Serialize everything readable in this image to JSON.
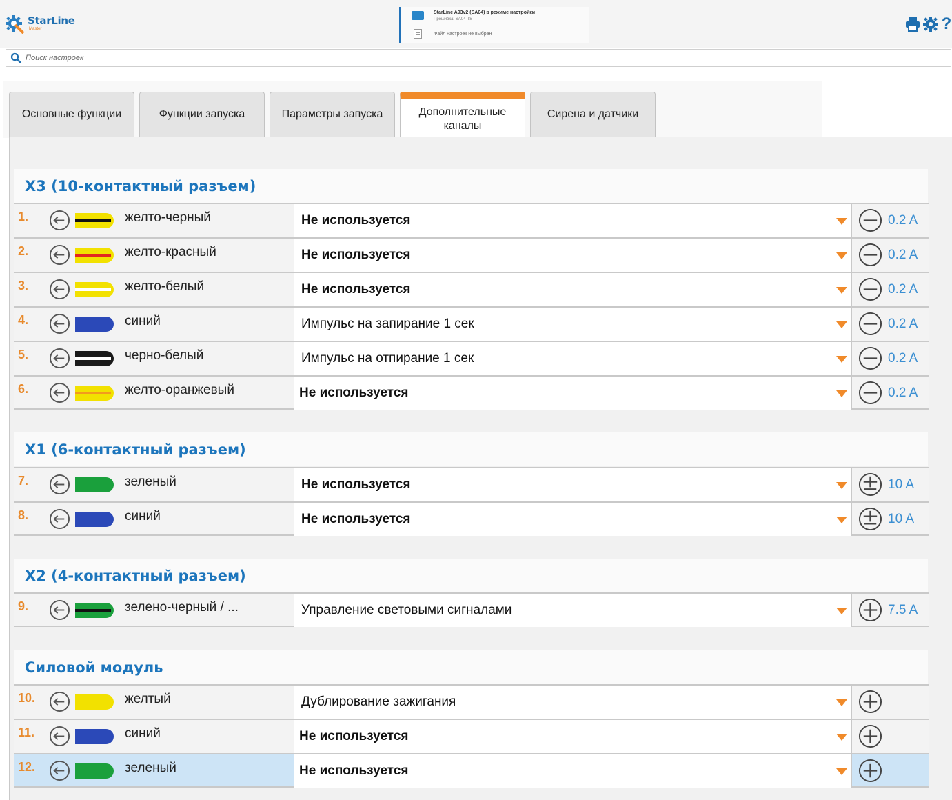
{
  "app": {
    "logo_name": "StarLine",
    "logo_sub": "Master",
    "device_title": "StarLine A93v2 (SA04) в режиме настройки",
    "device_firmware": "Прошивка: SA04-TS",
    "device_file": "Файл настроек не выбран"
  },
  "search": {
    "placeholder": "Поиск настроек"
  },
  "tabs": [
    {
      "label": "Основные функции"
    },
    {
      "label": "Функции запуска"
    },
    {
      "label": "Параметры запуска"
    },
    {
      "label": "Дополнительные каналы",
      "active": true
    },
    {
      "label": "Сирена и датчики"
    }
  ],
  "sections": [
    {
      "title": "X3 (10-контактный разъем)",
      "rows": [
        {
          "num": "1.",
          "wire_base": "#f2e100",
          "wire_stripe": "#111111",
          "label": "желто-черный",
          "value": "Не используется",
          "polarity": "minus",
          "current": "0.2 A"
        },
        {
          "num": "2.",
          "wire_base": "#f2e100",
          "wire_stripe": "#e3261f",
          "label": "желто-красный",
          "value": "Не используется",
          "polarity": "minus",
          "current": "0.2 A"
        },
        {
          "num": "3.",
          "wire_base": "#f2e100",
          "wire_stripe": "#ffffff",
          "label": "желто-белый",
          "value": "Не используется",
          "polarity": "minus",
          "current": "0.2 A"
        },
        {
          "num": "4.",
          "wire_base": "#2b49b8",
          "wire_stripe": "",
          "label": "синий",
          "value": "Импульс на запирание 1 сек",
          "polarity": "minus",
          "current": "0.2 A"
        },
        {
          "num": "5.",
          "wire_base": "#1a1a1a",
          "wire_stripe": "#ffffff",
          "label": "черно-белый",
          "value": "Импульс на отпирание 1 сек",
          "polarity": "minus",
          "current": "0.2 A"
        },
        {
          "num": "6.",
          "wire_base": "#f2e100",
          "wire_stripe": "#f39a1e",
          "label": "желто-оранжевый",
          "value": "Не используется",
          "polarity": "minus",
          "current": "0.2 A"
        }
      ]
    },
    {
      "title": "X1 (6-контактный разъем)",
      "rows": [
        {
          "num": "7.",
          "wire_base": "#1aa03c",
          "wire_stripe": "",
          "label": "зеленый",
          "value": "Не используется",
          "polarity": "plus-minus",
          "current": "10 A"
        },
        {
          "num": "8.",
          "wire_base": "#2b49b8",
          "wire_stripe": "",
          "label": "синий",
          "value": "Не используется",
          "polarity": "plus-minus",
          "current": "10 A"
        }
      ]
    },
    {
      "title": "X2 (4-контактный разъем)",
      "rows": [
        {
          "num": "9.",
          "wire_base": "#1aa03c",
          "wire_stripe": "#111111",
          "label": "зелено-черный / ...",
          "value": "Управление световыми сигналами",
          "polarity": "plus",
          "current": "7.5 A"
        }
      ]
    },
    {
      "title": "Силовой модуль",
      "rows": [
        {
          "num": "10.",
          "wire_base": "#f2e100",
          "wire_stripe": "",
          "label": "желтый",
          "value": "Дублирование зажигания",
          "polarity": "plus",
          "current": ""
        },
        {
          "num": "11.",
          "wire_base": "#2b49b8",
          "wire_stripe": "",
          "label": "синий",
          "value": "Не используется",
          "polarity": "plus",
          "current": ""
        },
        {
          "num": "12.",
          "wire_base": "#1aa03c",
          "wire_stripe": "",
          "label": "зеленый",
          "value": "Не используется",
          "polarity": "plus",
          "current": "",
          "selected": true
        }
      ]
    }
  ],
  "colors": {
    "accent": "#f08a2a",
    "heading": "#1c75bc",
    "current": "#3b8fd2",
    "selected_row": "#cde4f6"
  }
}
